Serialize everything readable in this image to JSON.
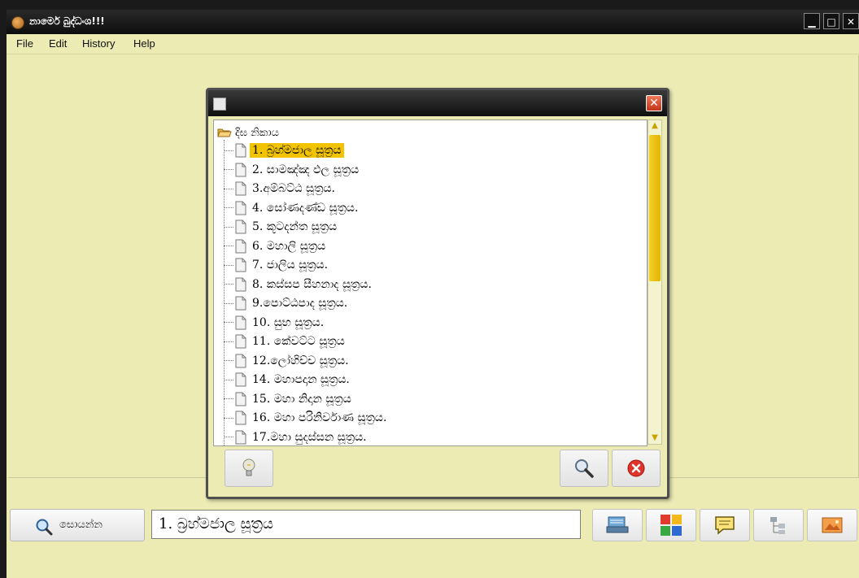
{
  "window": {
    "title": "නාමෙර් බුද්ධංශ!!!",
    "controls": [
      "minimize",
      "maximize",
      "close"
    ]
  },
  "menu": [
    "File",
    "Edit",
    "History",
    "Help"
  ],
  "dialog": {
    "tree": {
      "root_label": "දිඝ නිකාය",
      "selected_index": 0,
      "items": [
        "1. බ්‍රහ්මජාල සූත්‍රය",
        "2. සාමඤ්ඤ ඵල සූත්‍රය",
        "3.අම්බට්ඨ සූත්‍රය.",
        "4. සෝණදණ්ඩ සූත්‍රය.",
        "5. කූටදන්ත සූත්‍රය",
        "6. මහාලි සූත්‍රය",
        "7. ජාලිය සූත්‍රය.",
        "8. කස්සප සීහනාද සූත්‍රය.",
        "9.පොට්ඨපාද සූත්‍රය.",
        "10. සුභ සූත්‍රය.",
        "11. කේවට්ට සූත්‍රය",
        "12.ලෝහිච්ච සූත්‍රය.",
        "14. මහාපදාන සූත්‍රය.",
        "15. මහා නිදාන සූත්‍රය",
        "16. මහා පරිනිර්වාණ සූත්‍රය.",
        "17.මහා සුදස්සන සූත්‍රය."
      ]
    },
    "buttons": {
      "hint": "lightbulb-icon",
      "search": "magnifier-icon",
      "cancel": "red-x-icon"
    }
  },
  "bottom": {
    "search_button_label": "සොයන්න",
    "search_value": "1. බ්‍රහ්මජාල සූත්‍රය"
  },
  "colors": {
    "background": "#ecebb4",
    "selection": "#f2c400",
    "titlebar": "#1a1a1a"
  }
}
